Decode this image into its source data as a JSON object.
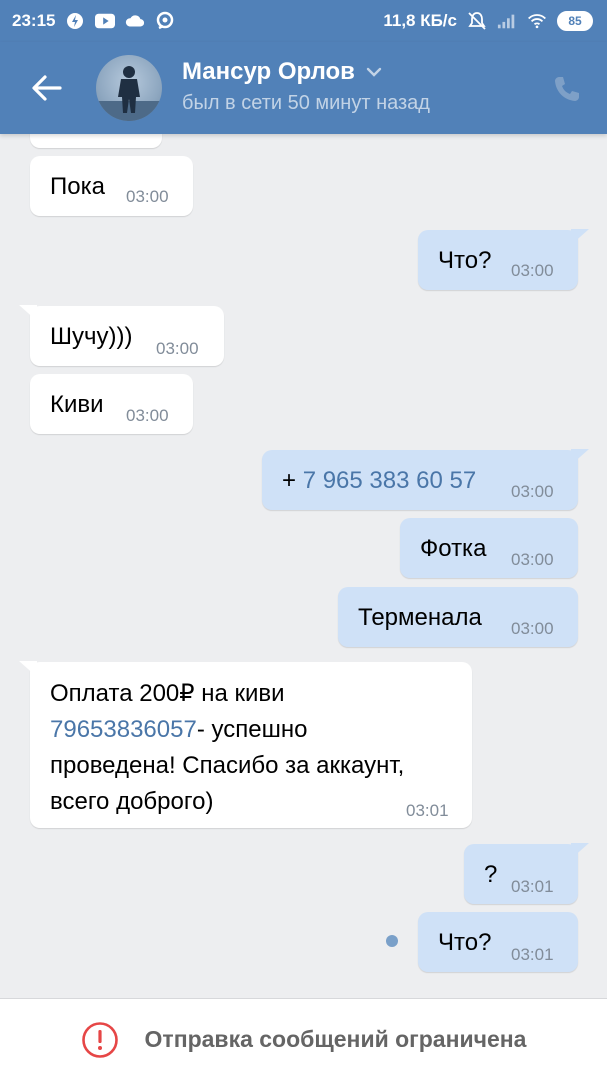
{
  "status_bar": {
    "time": "23:15",
    "network_speed": "11,8 КБ/с",
    "battery": "85",
    "icons": [
      "power-saver-icon",
      "youtube-icon",
      "cloud-icon",
      "sync-icon",
      "mute-icon",
      "signal-icon",
      "wifi-icon"
    ]
  },
  "header": {
    "contact_name": "Мансур Орлов",
    "last_seen": "был в сети 50 минут назад"
  },
  "messages": [
    {
      "dir": "in",
      "text": "Пока",
      "time": "03:00"
    },
    {
      "dir": "out",
      "text": "Что?",
      "time": "03:00"
    },
    {
      "dir": "in",
      "text": "Шучу)))",
      "time": "03:00"
    },
    {
      "dir": "in",
      "text": "Киви",
      "time": "03:00"
    },
    {
      "dir": "out",
      "text_prefix": "+ ",
      "link": "7 965 383 60 57",
      "time": "03:00"
    },
    {
      "dir": "out",
      "text": "Фотка",
      "time": "03:00"
    },
    {
      "dir": "out",
      "text": "Терменала",
      "time": "03:00"
    },
    {
      "dir": "in",
      "line1": "Оплата 200₽ на киви",
      "link": "79653836057",
      "line2_suffix": "- успешно",
      "line3": "проведена! Спасибо за аккаунт,",
      "line4": "всего доброго)",
      "time": "03:01"
    },
    {
      "dir": "out",
      "text": "?",
      "time": "03:01"
    },
    {
      "dir": "out",
      "text": "Что?",
      "time": "03:01",
      "unread": true
    }
  ],
  "bottom_bar": {
    "restriction_text": "Отправка сообщений ограничена"
  },
  "colors": {
    "accent": "#5181b8",
    "incoming_bubble": "#ffffff",
    "outgoing_bubble": "#cfe1f7",
    "link": "#4a76a8",
    "warning": "#e64646"
  }
}
